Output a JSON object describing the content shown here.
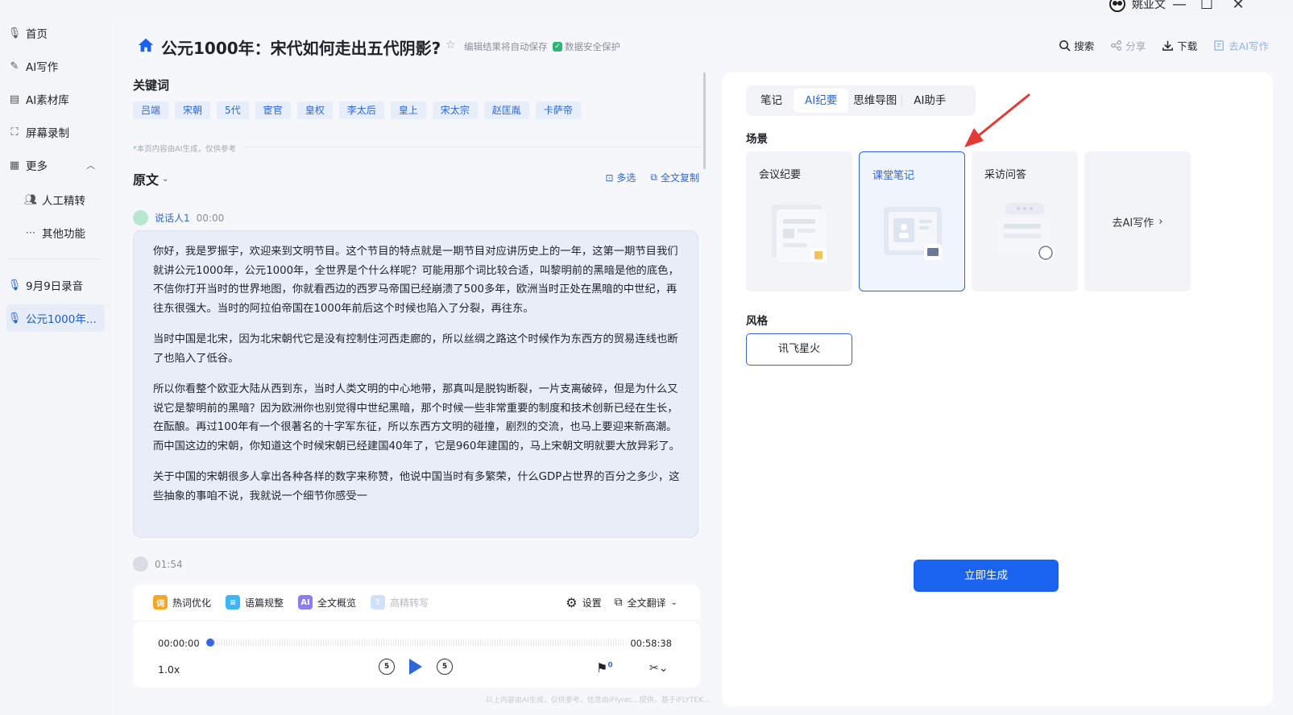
{
  "window": {
    "user_name": "姚亚文",
    "minimize": "—",
    "maximize": "☐",
    "close": "✕"
  },
  "sidebar": {
    "items": [
      {
        "label": "首页",
        "icon": "mic-icon"
      },
      {
        "label": "AI写作",
        "icon": "edit-icon"
      },
      {
        "label": "AI素材库",
        "icon": "library-icon"
      },
      {
        "label": "屏幕录制",
        "icon": "screen-record-icon"
      },
      {
        "label": "更多",
        "icon": "grid-icon"
      },
      {
        "label": "人工精转",
        "icon": "people-icon"
      },
      {
        "label": "其他功能",
        "icon": "more-icon"
      },
      {
        "label": "9月9日录音",
        "icon": "mic-icon"
      },
      {
        "label": "公元1000年...",
        "icon": "mic-icon"
      }
    ]
  },
  "header": {
    "title": "公元1000年：宋代如何走出五代阴影?",
    "autosave": "编辑结果将自动保存",
    "security": "数据安全保护",
    "actions": {
      "search": "搜索",
      "share": "分享",
      "download": "下载",
      "ai_write": "去AI写作"
    }
  },
  "keywords": {
    "title": "关键词",
    "items": [
      "吕端",
      "宋朝",
      "5代",
      "宦官",
      "皇权",
      "李太后",
      "皇上",
      "宋太宗",
      "赵匡胤",
      "卡萨帝"
    ],
    "note": "*本页内容由AI生成，仅供参考"
  },
  "original": {
    "title": "原文",
    "multi_select": "多选",
    "copy_all": "全文复制",
    "speaker1": {
      "name": "说话人1",
      "time": "00:00"
    },
    "paragraphs": [
      "你好，我是罗振宇，欢迎来到文明节目。这个节目的特点就是一期节目对应讲历史上的一年，这第一期节目我们就讲公元1000年，公元1000年，全世界是个什么样呢？可能用那个词比较合适，叫黎明前的黑暗是他的底色，不信你打开当时的世界地图，你就看西边的西罗马帝国已经崩溃了500多年，欧洲当时正处在黑暗的中世纪，再往东很强大。当时的阿拉伯帝国在1000年前后这个时候也陷入了分裂，再往东。",
      "当时中国是北宋，因为北宋朝代它是没有控制住河西走廊的，所以丝绸之路这个时候作为东西方的贸易连线也断了也陷入了低谷。",
      "所以你看整个欧亚大陆从西到东，当时人类文明的中心地带，那真叫是脱钩断裂，一片支离破碎，但是为什么又说它是黎明前的黑暗？因为欧洲你也别觉得中世纪黑暗，那个时候一些非常重要的制度和技术创新已经在生长，在酝酿。再过100年有一个很著名的十字军东征，所以东西方文明的碰撞，剧烈的交流，也马上要迎来新高潮。而中国这边的宋朝，你知道这个时候宋朝已经建国40年了，它是960年建国的，马上宋朝文明就要大放异彩了。",
      "关于中国的宋朝很多人拿出各种各样的数字来称赞，他说中国当时有多繁荣，什么GDP占世界的百分之多少，这些抽象的事咱不说，我就说一个细节你感受一"
    ],
    "speaker2_time": "01:54"
  },
  "tools": {
    "hot_words": "热词优化",
    "hot_words_icon": "词",
    "paragraph": "语篇规整",
    "overview": "全文概览",
    "hd_transcribe": "高精转写",
    "settings": "设置",
    "translate": "全文翻译"
  },
  "player": {
    "current": "00:00:00",
    "total": "00:58:38",
    "speed": "1.0x",
    "skip_seconds": "5",
    "flag_count": "0",
    "progress": 0
  },
  "footer": "以上内容由AI生成，仅供参考。信息由iFlyrec...提供，基于iFLYTEK...",
  "panel": {
    "tabs": [
      "笔记",
      "AI纪要",
      "思维导图",
      "AI助手"
    ],
    "active_tab": "AI纪要",
    "scene_label": "场景",
    "scenes": [
      "会议纪要",
      "课堂笔记",
      "采访问答"
    ],
    "scene_more": "去AI写作",
    "selected_scene": "课堂笔记",
    "style_label": "风格",
    "style_option": "讯飞星火",
    "generate": "立即生成"
  },
  "colors": {
    "accent": "#1a63f0",
    "annotation_arrow": "#e53935"
  }
}
